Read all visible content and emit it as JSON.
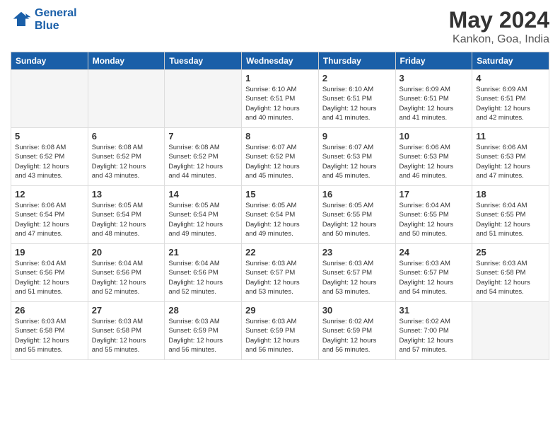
{
  "header": {
    "logo_line1": "General",
    "logo_line2": "Blue",
    "month_year": "May 2024",
    "location": "Kankon, Goa, India"
  },
  "days_of_week": [
    "Sunday",
    "Monday",
    "Tuesday",
    "Wednesday",
    "Thursday",
    "Friday",
    "Saturday"
  ],
  "weeks": [
    [
      {
        "num": "",
        "info": "",
        "empty": true
      },
      {
        "num": "",
        "info": "",
        "empty": true
      },
      {
        "num": "",
        "info": "",
        "empty": true
      },
      {
        "num": "1",
        "info": "Sunrise: 6:10 AM\nSunset: 6:51 PM\nDaylight: 12 hours\nand 40 minutes.",
        "empty": false
      },
      {
        "num": "2",
        "info": "Sunrise: 6:10 AM\nSunset: 6:51 PM\nDaylight: 12 hours\nand 41 minutes.",
        "empty": false
      },
      {
        "num": "3",
        "info": "Sunrise: 6:09 AM\nSunset: 6:51 PM\nDaylight: 12 hours\nand 41 minutes.",
        "empty": false
      },
      {
        "num": "4",
        "info": "Sunrise: 6:09 AM\nSunset: 6:51 PM\nDaylight: 12 hours\nand 42 minutes.",
        "empty": false
      }
    ],
    [
      {
        "num": "5",
        "info": "Sunrise: 6:08 AM\nSunset: 6:52 PM\nDaylight: 12 hours\nand 43 minutes.",
        "empty": false
      },
      {
        "num": "6",
        "info": "Sunrise: 6:08 AM\nSunset: 6:52 PM\nDaylight: 12 hours\nand 43 minutes.",
        "empty": false
      },
      {
        "num": "7",
        "info": "Sunrise: 6:08 AM\nSunset: 6:52 PM\nDaylight: 12 hours\nand 44 minutes.",
        "empty": false
      },
      {
        "num": "8",
        "info": "Sunrise: 6:07 AM\nSunset: 6:52 PM\nDaylight: 12 hours\nand 45 minutes.",
        "empty": false
      },
      {
        "num": "9",
        "info": "Sunrise: 6:07 AM\nSunset: 6:53 PM\nDaylight: 12 hours\nand 45 minutes.",
        "empty": false
      },
      {
        "num": "10",
        "info": "Sunrise: 6:06 AM\nSunset: 6:53 PM\nDaylight: 12 hours\nand 46 minutes.",
        "empty": false
      },
      {
        "num": "11",
        "info": "Sunrise: 6:06 AM\nSunset: 6:53 PM\nDaylight: 12 hours\nand 47 minutes.",
        "empty": false
      }
    ],
    [
      {
        "num": "12",
        "info": "Sunrise: 6:06 AM\nSunset: 6:54 PM\nDaylight: 12 hours\nand 47 minutes.",
        "empty": false
      },
      {
        "num": "13",
        "info": "Sunrise: 6:05 AM\nSunset: 6:54 PM\nDaylight: 12 hours\nand 48 minutes.",
        "empty": false
      },
      {
        "num": "14",
        "info": "Sunrise: 6:05 AM\nSunset: 6:54 PM\nDaylight: 12 hours\nand 49 minutes.",
        "empty": false
      },
      {
        "num": "15",
        "info": "Sunrise: 6:05 AM\nSunset: 6:54 PM\nDaylight: 12 hours\nand 49 minutes.",
        "empty": false
      },
      {
        "num": "16",
        "info": "Sunrise: 6:05 AM\nSunset: 6:55 PM\nDaylight: 12 hours\nand 50 minutes.",
        "empty": false
      },
      {
        "num": "17",
        "info": "Sunrise: 6:04 AM\nSunset: 6:55 PM\nDaylight: 12 hours\nand 50 minutes.",
        "empty": false
      },
      {
        "num": "18",
        "info": "Sunrise: 6:04 AM\nSunset: 6:55 PM\nDaylight: 12 hours\nand 51 minutes.",
        "empty": false
      }
    ],
    [
      {
        "num": "19",
        "info": "Sunrise: 6:04 AM\nSunset: 6:56 PM\nDaylight: 12 hours\nand 51 minutes.",
        "empty": false
      },
      {
        "num": "20",
        "info": "Sunrise: 6:04 AM\nSunset: 6:56 PM\nDaylight: 12 hours\nand 52 minutes.",
        "empty": false
      },
      {
        "num": "21",
        "info": "Sunrise: 6:04 AM\nSunset: 6:56 PM\nDaylight: 12 hours\nand 52 minutes.",
        "empty": false
      },
      {
        "num": "22",
        "info": "Sunrise: 6:03 AM\nSunset: 6:57 PM\nDaylight: 12 hours\nand 53 minutes.",
        "empty": false
      },
      {
        "num": "23",
        "info": "Sunrise: 6:03 AM\nSunset: 6:57 PM\nDaylight: 12 hours\nand 53 minutes.",
        "empty": false
      },
      {
        "num": "24",
        "info": "Sunrise: 6:03 AM\nSunset: 6:57 PM\nDaylight: 12 hours\nand 54 minutes.",
        "empty": false
      },
      {
        "num": "25",
        "info": "Sunrise: 6:03 AM\nSunset: 6:58 PM\nDaylight: 12 hours\nand 54 minutes.",
        "empty": false
      }
    ],
    [
      {
        "num": "26",
        "info": "Sunrise: 6:03 AM\nSunset: 6:58 PM\nDaylight: 12 hours\nand 55 minutes.",
        "empty": false
      },
      {
        "num": "27",
        "info": "Sunrise: 6:03 AM\nSunset: 6:58 PM\nDaylight: 12 hours\nand 55 minutes.",
        "empty": false
      },
      {
        "num": "28",
        "info": "Sunrise: 6:03 AM\nSunset: 6:59 PM\nDaylight: 12 hours\nand 56 minutes.",
        "empty": false
      },
      {
        "num": "29",
        "info": "Sunrise: 6:03 AM\nSunset: 6:59 PM\nDaylight: 12 hours\nand 56 minutes.",
        "empty": false
      },
      {
        "num": "30",
        "info": "Sunrise: 6:02 AM\nSunset: 6:59 PM\nDaylight: 12 hours\nand 56 minutes.",
        "empty": false
      },
      {
        "num": "31",
        "info": "Sunrise: 6:02 AM\nSunset: 7:00 PM\nDaylight: 12 hours\nand 57 minutes.",
        "empty": false
      },
      {
        "num": "",
        "info": "",
        "empty": true
      }
    ]
  ]
}
